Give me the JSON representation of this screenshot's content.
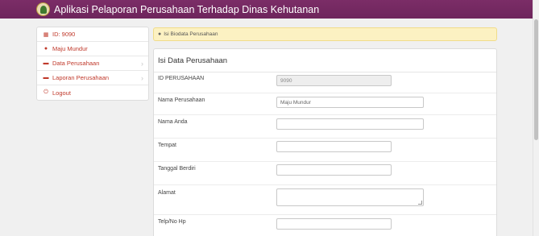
{
  "app": {
    "title": "Aplikasi Pelaporan Perusahaan Terhadap Dinas Kehutanan"
  },
  "sidebar": {
    "items": [
      {
        "icon": "id-card-icon",
        "label": "ID: 9090"
      },
      {
        "icon": "user-icon",
        "label": "Maju Mundur"
      },
      {
        "icon": "folder-icon",
        "label": "Data Perusahaan"
      },
      {
        "icon": "folder-icon",
        "label": "Laporan Perusahaan"
      },
      {
        "icon": "power-icon",
        "label": "Logout"
      }
    ]
  },
  "alert": {
    "text": "Isi Biodata Perusahaan"
  },
  "form": {
    "title": "Isi Data Perusahaan",
    "fields": [
      {
        "label": "ID PERUSAHAAN",
        "value": "9090",
        "readonly": true
      },
      {
        "label": "Nama Perusahaan",
        "value": "Maju Mundur"
      },
      {
        "label": "Nama Anda",
        "value": ""
      },
      {
        "label": "Tempat",
        "value": ""
      },
      {
        "label": "Tanggal Berdiri",
        "value": ""
      },
      {
        "label": "Alamat",
        "value": ""
      },
      {
        "label": "Telp/No Hp",
        "value": ""
      }
    ]
  }
}
